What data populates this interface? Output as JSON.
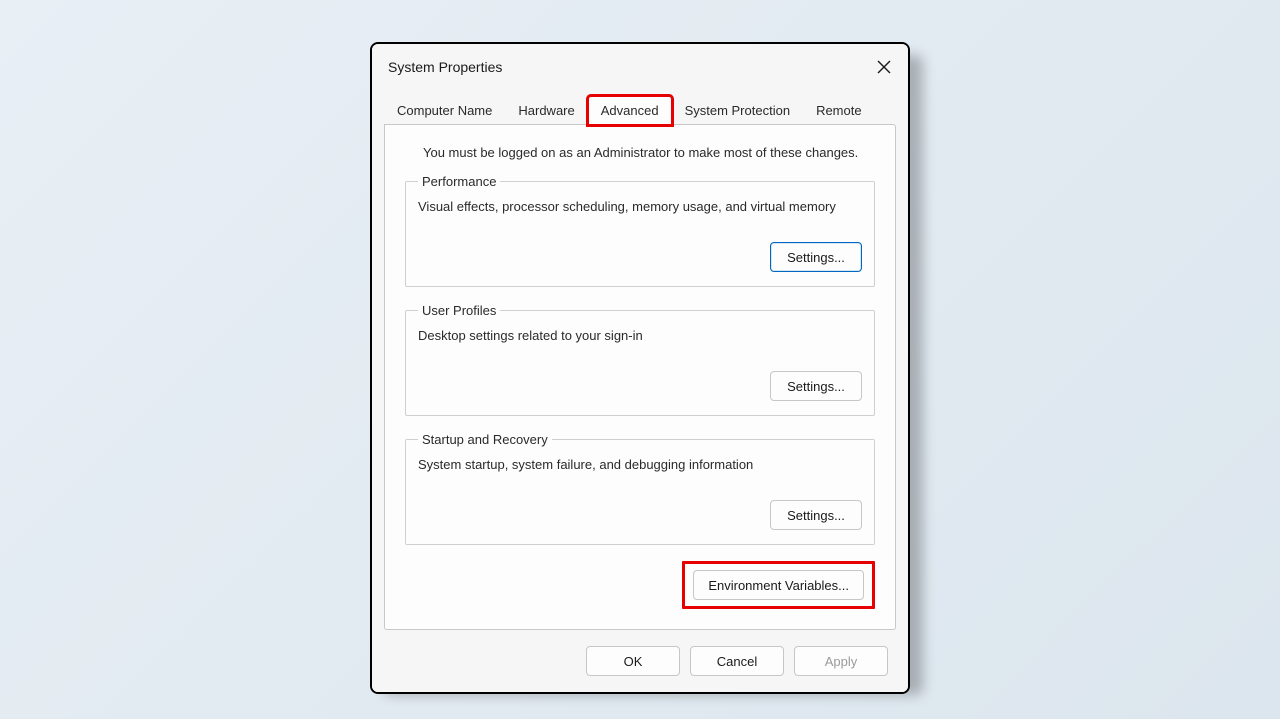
{
  "dialog": {
    "title": "System Properties",
    "tabs": [
      {
        "label": "Computer Name"
      },
      {
        "label": "Hardware"
      },
      {
        "label": "Advanced",
        "active": true,
        "highlighted": true
      },
      {
        "label": "System Protection"
      },
      {
        "label": "Remote"
      }
    ],
    "intro": "You must be logged on as an Administrator to make most of these changes.",
    "groups": {
      "performance": {
        "legend": "Performance",
        "desc": "Visual effects, processor scheduling, memory usage, and virtual memory",
        "button": "Settings..."
      },
      "userProfiles": {
        "legend": "User Profiles",
        "desc": "Desktop settings related to your sign-in",
        "button": "Settings..."
      },
      "startup": {
        "legend": "Startup and Recovery",
        "desc": "System startup, system failure, and debugging information",
        "button": "Settings..."
      }
    },
    "envButton": "Environment Variables...",
    "footer": {
      "ok": "OK",
      "cancel": "Cancel",
      "apply": "Apply"
    }
  }
}
